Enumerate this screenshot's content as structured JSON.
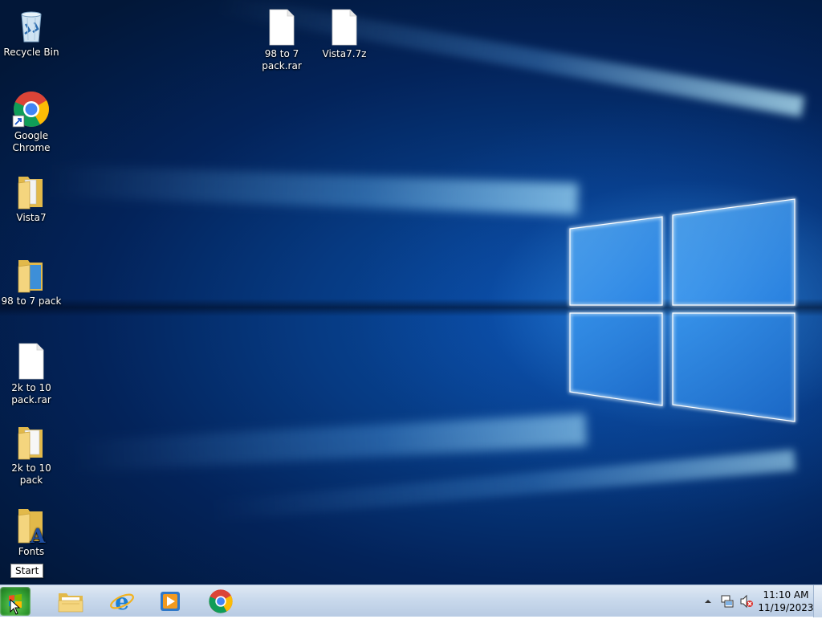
{
  "desktop": {
    "icons": [
      {
        "label": "Recycle Bin",
        "icon": "recycle-bin-icon"
      },
      {
        "label": "Google Chrome",
        "icon": "chrome-icon"
      },
      {
        "label": "Vista7",
        "icon": "folder-icon"
      },
      {
        "label": "98 to 7 pack",
        "icon": "folder-icon"
      },
      {
        "label": "2k to 10 pack.rar",
        "icon": "file-icon"
      },
      {
        "label": "2k to 10 pack",
        "icon": "folder-icon"
      },
      {
        "label": "Fonts",
        "icon": "fonts-folder-icon"
      },
      {
        "label": "98 to 7 pack.rar",
        "icon": "file-icon"
      },
      {
        "label": "Vista7.7z",
        "icon": "file-icon"
      }
    ]
  },
  "taskbar": {
    "start_tooltip": "Start",
    "pinned": [
      "file-explorer-icon",
      "internet-explorer-icon",
      "media-player-icon",
      "chrome-icon"
    ],
    "clock": {
      "time": "11:10 AM",
      "date": "11/19/2023"
    }
  },
  "colors": {
    "taskbar": "#c9d9ec",
    "desktop_bg": "#063a82",
    "start_orb": "#2f9a2f"
  }
}
